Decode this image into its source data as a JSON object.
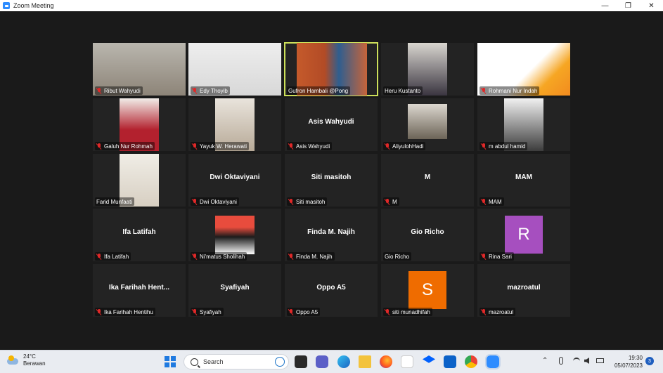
{
  "window": {
    "title": "Zoom Meeting",
    "minimize": "—",
    "maximize": "❐",
    "close": "✕"
  },
  "participants": [
    {
      "name": "Ribut Wahyudi",
      "muted": true,
      "video": true,
      "active": false
    },
    {
      "name": "Edy Thoyib",
      "muted": true,
      "video": true,
      "active": false
    },
    {
      "name": "Gufron Hambali @Pong",
      "muted": false,
      "video": true,
      "active": true
    },
    {
      "name": "Heru Kustanto",
      "muted": false,
      "video": true,
      "active": false
    },
    {
      "name": "Rohmani Nur Indah",
      "muted": true,
      "video": true,
      "active": false
    },
    {
      "name": "Galuh Nur Rohmah",
      "muted": true,
      "video": true,
      "active": false
    },
    {
      "name": "Yayuk W. Herawati",
      "muted": true,
      "video": true,
      "active": false
    },
    {
      "name": "Asis Wahyudi",
      "muted": true,
      "video": false,
      "center": "Asis Wahyudi",
      "active": false
    },
    {
      "name": "AliyulohHadi",
      "muted": true,
      "video": true,
      "active": false
    },
    {
      "name": "m abdul hamid",
      "muted": true,
      "video": true,
      "active": false
    },
    {
      "name": "Farid Munfaati",
      "muted": false,
      "video": true,
      "active": false
    },
    {
      "name": "Dwi Oktaviyani",
      "muted": true,
      "video": false,
      "center": "Dwi Oktaviyani",
      "active": false
    },
    {
      "name": "Siti masitoh",
      "muted": true,
      "video": false,
      "center": "Siti masitoh",
      "active": false
    },
    {
      "name": "M",
      "muted": true,
      "video": false,
      "center": "M",
      "active": false
    },
    {
      "name": "MAM",
      "muted": true,
      "video": false,
      "center": "MAM",
      "active": false
    },
    {
      "name": "Ifa Latifah",
      "muted": true,
      "video": false,
      "center": "Ifa Latifah",
      "active": false
    },
    {
      "name": "Ni'matus Sholihah",
      "muted": true,
      "video": true,
      "active": false
    },
    {
      "name": "Finda M. Najih",
      "muted": true,
      "video": false,
      "center": "Finda M. Najih",
      "active": false
    },
    {
      "name": "Gio Richo",
      "muted": false,
      "video": false,
      "center": "Gio Richo",
      "active": false
    },
    {
      "name": "Rina Sari",
      "muted": true,
      "video": false,
      "avatar": "R",
      "avatar_color": "#a64fbf",
      "active": false
    },
    {
      "name": "Ika Farihah Hentihu",
      "muted": true,
      "video": false,
      "center": "Ika  Farihah  Hent...",
      "active": false
    },
    {
      "name": "Syafiyah",
      "muted": true,
      "video": false,
      "center": "Syafiyah",
      "active": false
    },
    {
      "name": "Oppo A5",
      "muted": true,
      "video": false,
      "center": "Oppo A5",
      "active": false
    },
    {
      "name": "siti munadhifah",
      "muted": true,
      "video": false,
      "avatar": "S",
      "avatar_color": "#ef6c00",
      "active": false
    },
    {
      "name": "mazroatul",
      "muted": true,
      "video": false,
      "center": "mazroatul",
      "active": false
    }
  ],
  "taskbar": {
    "weather": {
      "temp": "24°C",
      "condition": "Berawan"
    },
    "search_placeholder": "Search",
    "time": "19:30",
    "date": "05/07/2023",
    "notifications": "3",
    "tray_arrow": "⌃"
  }
}
